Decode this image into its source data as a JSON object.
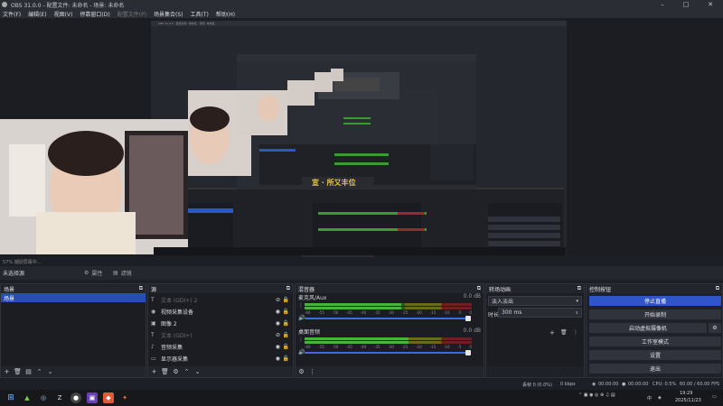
{
  "window": {
    "title": "OBS 31.0.0 - 配置文件: 未命名 - 场景: 未命名"
  },
  "menu": {
    "items": [
      "文件(F)",
      "编辑(E)",
      "视图(V)",
      "停靠窗口(D)",
      "配置文件(P)",
      "场景集合(S)",
      "工具(T)",
      "帮助(H)"
    ],
    "disabled": [
      "配置文件(P)"
    ]
  },
  "preview": {
    "status_text": "57%    捕捉屏幕中...",
    "banner_text": "宣 · 所又丰位",
    "inner_title": "OBS 31.0.0 - 配置文件: 未命名 - 场景: 未命名"
  },
  "sourcebar": {
    "label": "未选择源",
    "properties": "属性",
    "filters": "滤镜"
  },
  "scenes": {
    "title": "场景",
    "items": [
      "场景"
    ]
  },
  "sources": {
    "title": "源",
    "items": [
      {
        "name": "文本 (GDI+) 2",
        "icon": "text-icon",
        "visible": false
      },
      {
        "name": "视频采集设备",
        "icon": "camera-icon",
        "visible": true
      },
      {
        "name": "图像 2",
        "icon": "image-icon",
        "visible": true
      },
      {
        "name": "文本 (GDI+)",
        "icon": "text-icon",
        "visible": false
      },
      {
        "name": "音频采集",
        "icon": "audio-icon",
        "visible": true
      },
      {
        "name": "显示器采集",
        "icon": "monitor-icon",
        "visible": true
      }
    ]
  },
  "mixer": {
    "title": "混音器",
    "channels": [
      {
        "name": "麦克风/Aux",
        "db": "0.0 dB",
        "level": 0.58,
        "volume": 1.0
      },
      {
        "name": "桌面音频",
        "db": "0.0 dB",
        "level": 0.62,
        "volume": 1.0
      }
    ],
    "ticks": [
      "-60",
      "-55",
      "-50",
      "-45",
      "-40",
      "-35",
      "-30",
      "-25",
      "-20",
      "-15",
      "-10",
      "-5",
      "0"
    ]
  },
  "transitions": {
    "title": "转场动画",
    "selected": "淡入淡出",
    "duration_label": "时长",
    "duration_value": "300 ms"
  },
  "controls": {
    "title": "控制按钮",
    "buttons": [
      "停止直播",
      "开始录制",
      "启动虚拟摄像机",
      "工作室模式",
      "设置",
      "退出"
    ]
  },
  "statusbar": {
    "dropped": "丢帧 0 (0.0%)",
    "kbps": "0 kbps",
    "live_time": "00:00:00",
    "rec_time": "00:00:00",
    "cpu": "CPU: 0.5%",
    "fps": "60.00 / 60.00 FPS"
  },
  "taskbar": {
    "time": "19:29",
    "date": "2025/11/23",
    "lang": "中"
  },
  "colors": {
    "accent": "#2f56c9",
    "meter_green": "#46b33a",
    "bg": "#1d1f26"
  }
}
